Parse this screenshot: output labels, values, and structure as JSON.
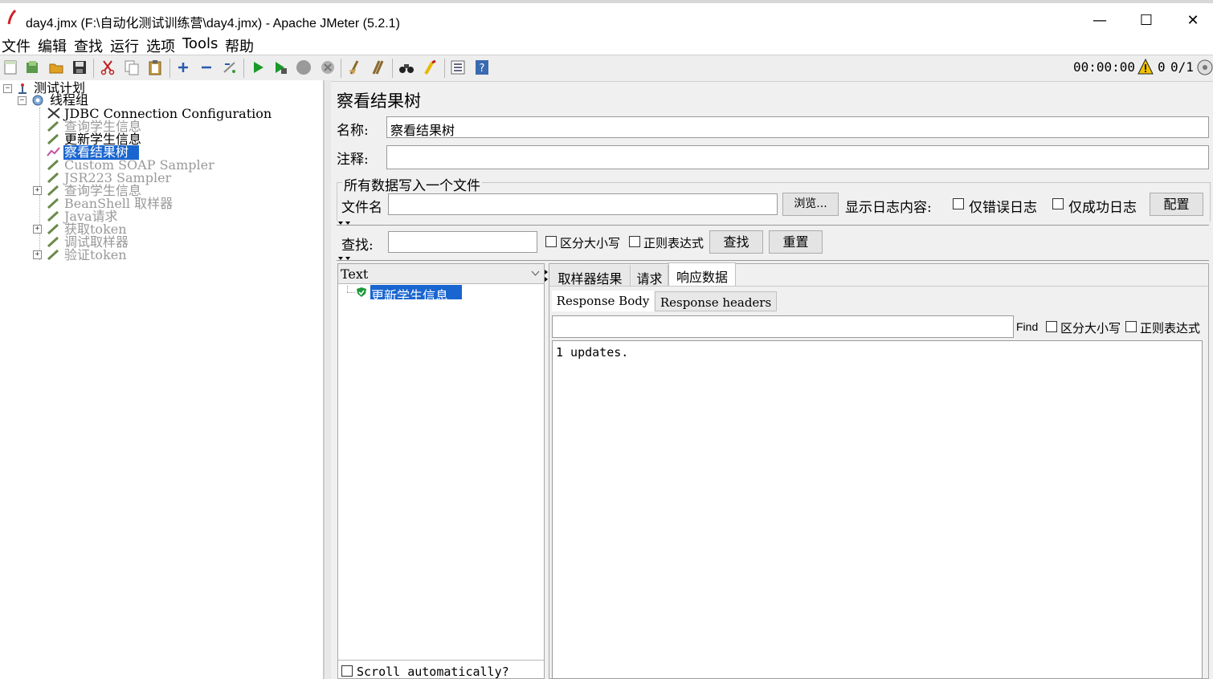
{
  "window": {
    "title": "day4.jmx (F:\\自动化测试训练营\\day4.jmx) - Apache JMeter (5.2.1)",
    "minimize": "—",
    "maximize": "☐",
    "close": "✕"
  },
  "menu": [
    "文件",
    "编辑",
    "查找",
    "运行",
    "选项",
    "Tools",
    "帮助"
  ],
  "status": {
    "timer": "00:00:00",
    "warnings": "0",
    "threads": "0/1"
  },
  "tree": {
    "root": "测试计划",
    "thread_group": "线程组",
    "items": [
      "JDBC Connection Configuration",
      "查询学生信息",
      "更新学生信息",
      "察看结果树",
      "Custom SOAP Sampler",
      "JSR223 Sampler",
      "查询学生信息",
      "BeanShell 取样器",
      "Java请求",
      "获取token",
      "调试取样器",
      "验证token"
    ]
  },
  "panel": {
    "title": "察看结果树",
    "name_label": "名称:",
    "name_value": "察看结果树",
    "comment_label": "注释:",
    "comment_value": "",
    "file_section": "所有数据写入一个文件",
    "filename_label": "文件名",
    "filename_value": "",
    "browse": "浏览...",
    "log_label": "显示日志内容:",
    "errors_only": "仅错误日志",
    "success_only": "仅成功日志",
    "configure": "配置"
  },
  "search": {
    "label": "查找:",
    "value": "",
    "case_sensitive": "区分大小写",
    "regex": "正则表达式",
    "find_button": "查找",
    "reset_button": "重置"
  },
  "results": {
    "renderer": "Text",
    "sample": "更新学生信息",
    "scroll_auto": "Scroll automatically?"
  },
  "tabs": [
    "取样器结果",
    "请求",
    "响应数据"
  ],
  "subtabs": [
    "Response Body",
    "Response headers"
  ],
  "find": {
    "label": "Find",
    "case_sensitive": "区分大小写",
    "regex": "正则表达式"
  },
  "response_body": "1 updates."
}
